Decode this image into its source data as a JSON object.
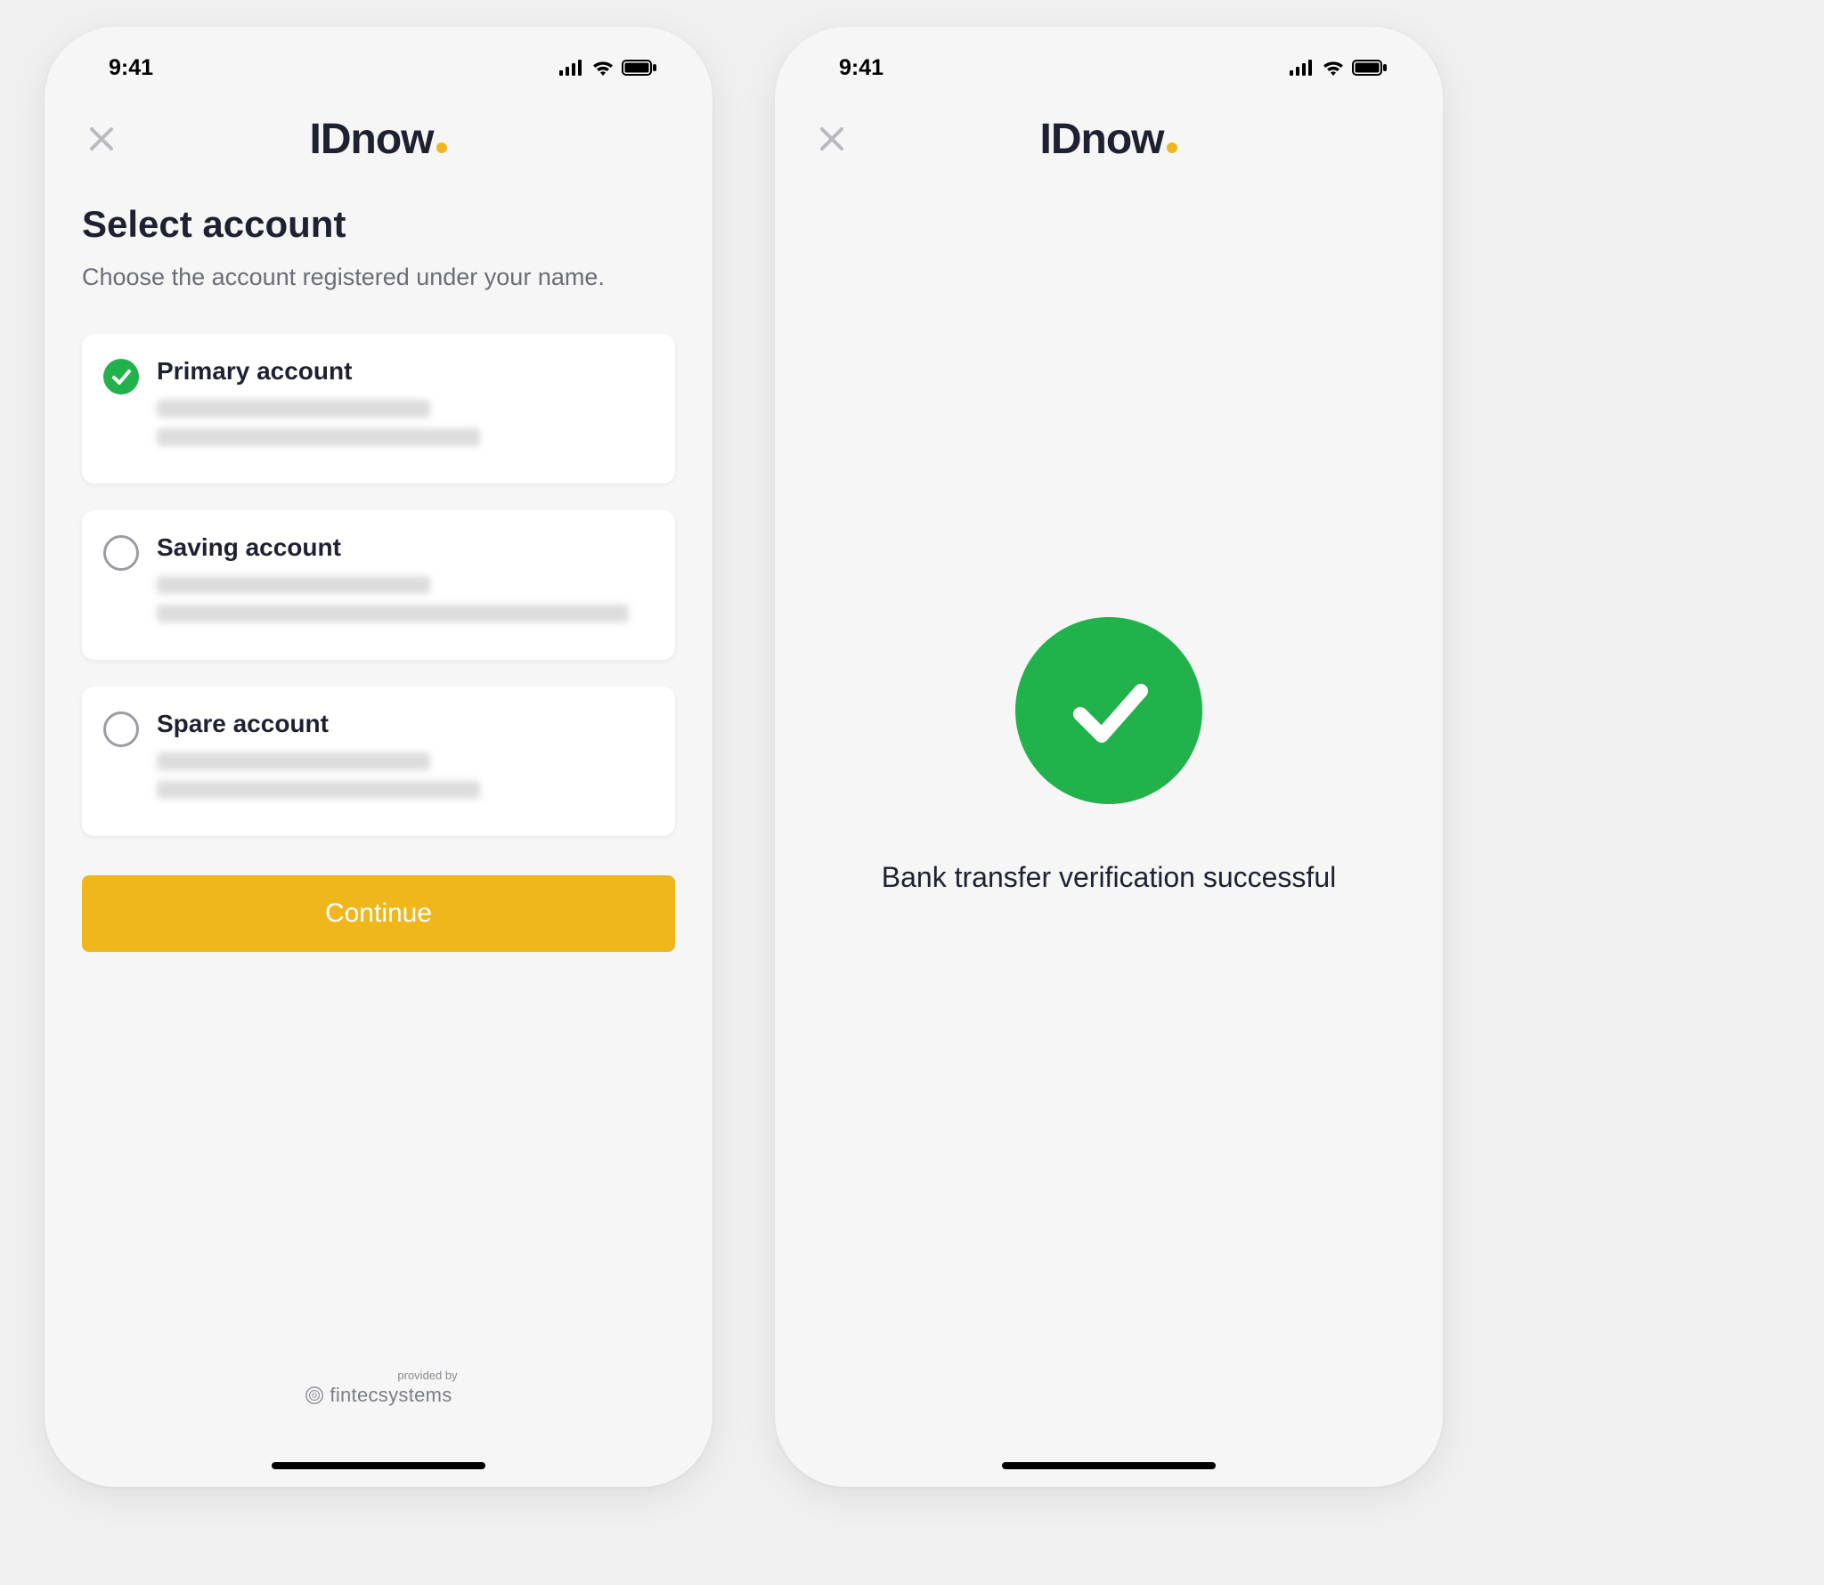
{
  "status": {
    "time": "9:41"
  },
  "brand": {
    "name": "IDnow"
  },
  "screen1": {
    "title": "Select account",
    "subtitle": "Choose the account registered under your name.",
    "accounts": [
      {
        "label": "Primary account",
        "selected": true
      },
      {
        "label": "Saving account",
        "selected": false
      },
      {
        "label": "Spare account",
        "selected": false
      }
    ],
    "continue_label": "Continue",
    "footer_prefix": "provided by",
    "footer_brand": "fintecsystems"
  },
  "screen2": {
    "message": "Bank transfer verification successful"
  },
  "colors": {
    "accent": "#f0b71d",
    "success": "#21b24b",
    "text_primary": "#1e2131",
    "text_secondary": "#6b6d77"
  }
}
